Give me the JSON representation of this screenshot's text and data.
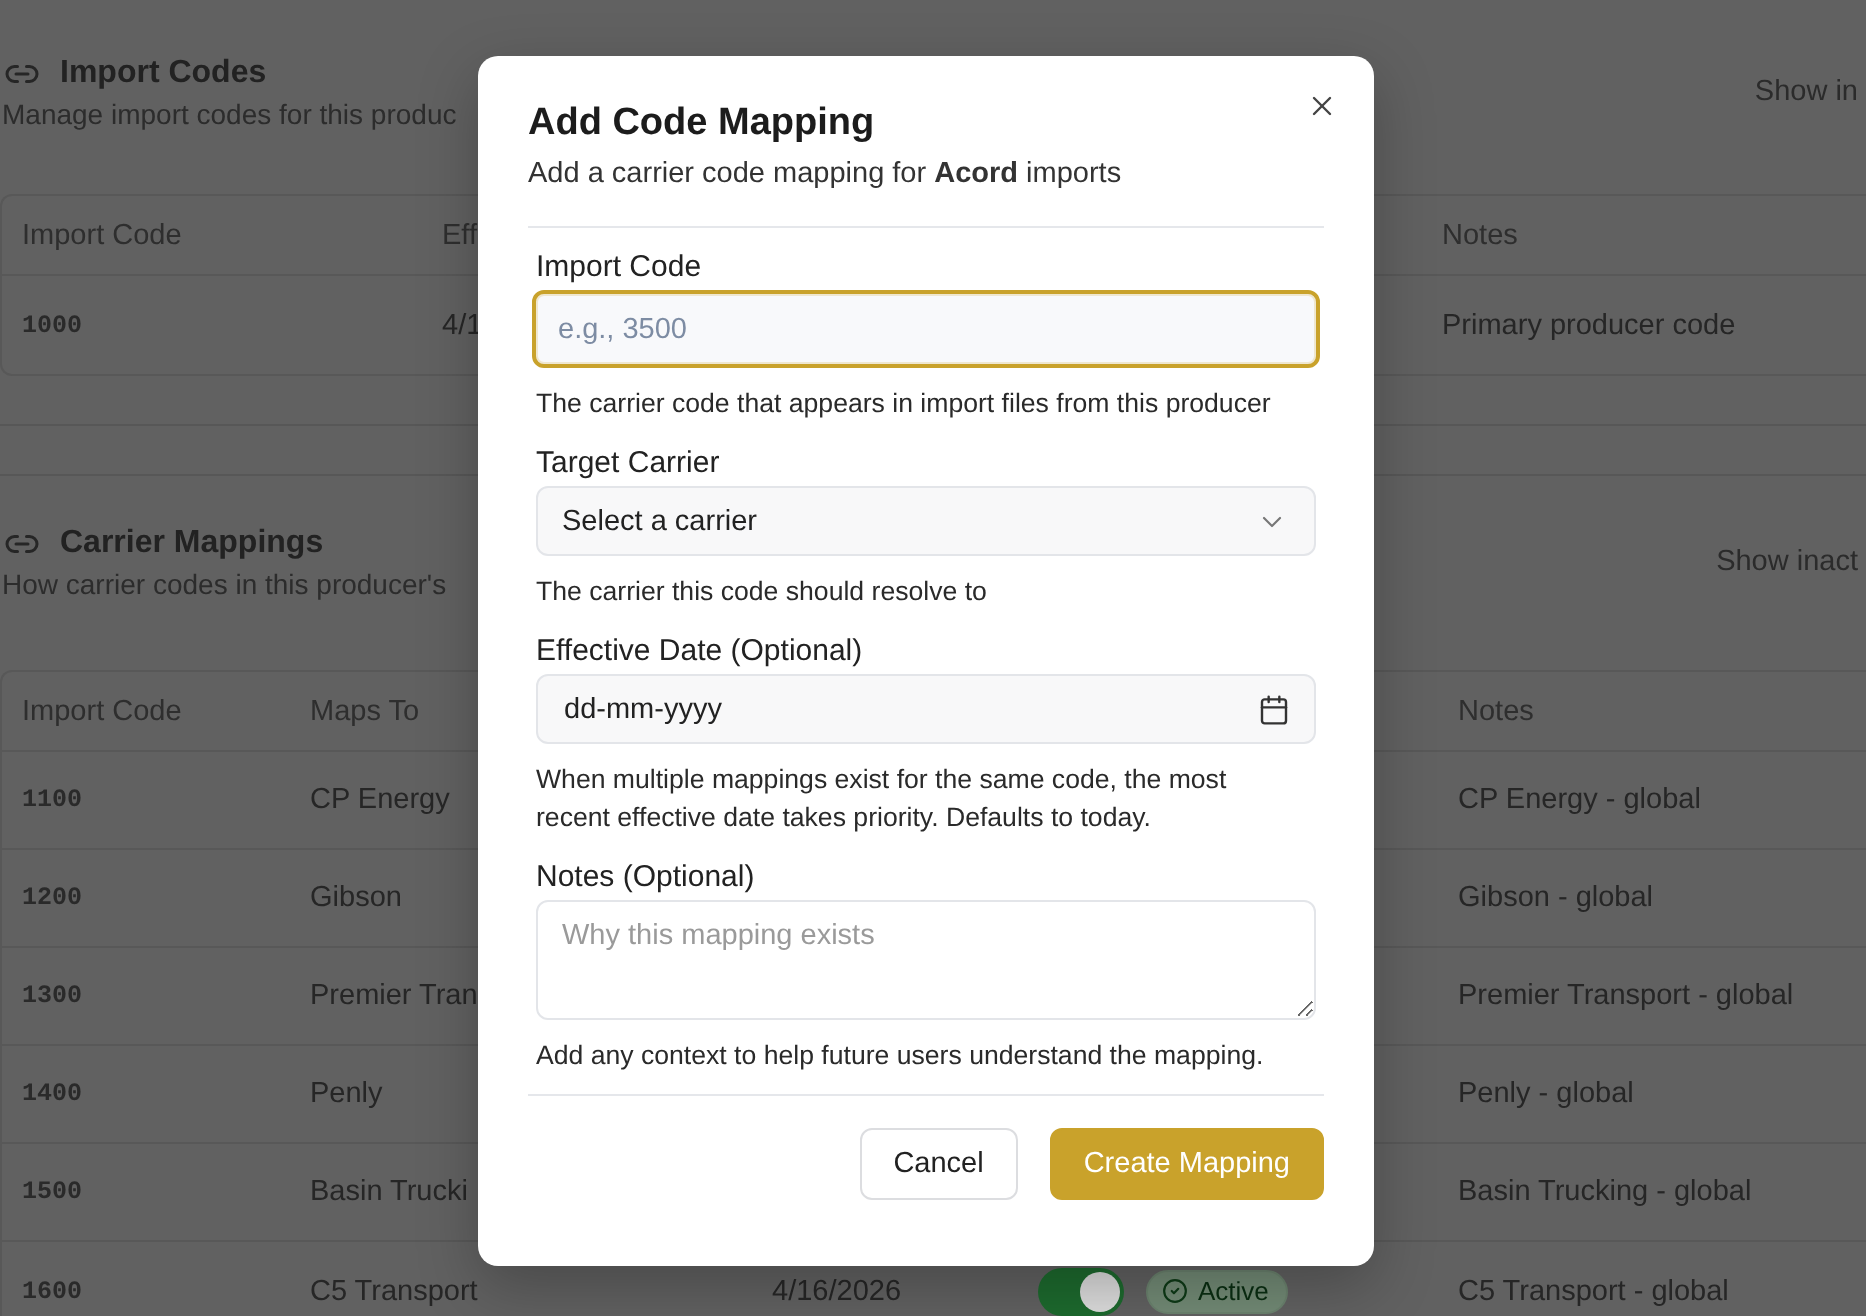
{
  "import_codes": {
    "title": "Import Codes",
    "subtitle": "Manage import codes for this produc",
    "filter_label": "Show in",
    "columns": [
      "Import Code",
      "Eff",
      "Notes"
    ],
    "rows": [
      {
        "import_code": "1000",
        "column_2": "4/1",
        "notes": "Primary producer code"
      }
    ]
  },
  "carrier_mappings": {
    "title": "Carrier Mappings",
    "subtitle": "How carrier codes in this producer's",
    "filter_label": "Show inact",
    "columns": [
      "Import Code",
      "Maps To",
      "Notes"
    ],
    "rows": [
      {
        "import_code": "1100",
        "maps_to": "CP Energy",
        "notes": "CP Energy - global"
      },
      {
        "import_code": "1200",
        "maps_to": "Gibson",
        "notes": "Gibson - global"
      },
      {
        "import_code": "1300",
        "maps_to": "Premier Tran",
        "notes": "Premier Transport - global"
      },
      {
        "import_code": "1400",
        "maps_to": "Penly",
        "notes": "Penly - global"
      },
      {
        "import_code": "1500",
        "maps_to": "Basin Trucki",
        "notes": "Basin Trucking - global"
      },
      {
        "import_code": "1600",
        "maps_to": "C5 Transport",
        "column_3": "4/16/2026",
        "column_4": {
          "on": true
        },
        "column_5": "Active",
        "notes": "C5 Transport - global"
      }
    ]
  },
  "dialog": {
    "title": "Add Code Mapping",
    "subtitle": "Add a carrier code mapping for **Acord** imports",
    "fields": [
      {
        "kind": "text",
        "label": "Import Code",
        "placeholder": "e.g., 3500",
        "focused": true,
        "hint": "The carrier code that appears in import files from this producer"
      },
      {
        "kind": "select",
        "label": "Target Carrier",
        "placeholder": "Select a carrier",
        "focused": false,
        "hint": "The carrier this code should resolve to"
      },
      {
        "kind": "date",
        "label": "Effective Date (Optional)",
        "placeholder": "dd-mm-yyyy",
        "focused": false,
        "hint": "When multiple mappings exist for the same code, the most recent effective date takes priority. Defaults to today."
      },
      {
        "kind": "textarea",
        "label": "Notes (Optional)",
        "placeholder": "Why this mapping exists",
        "focused": false,
        "hint": "Add any context to help future users understand the mapping."
      }
    ],
    "buttons": [
      {
        "kind": "cancel",
        "label": "Cancel"
      },
      {
        "kind": "submit",
        "label": "Create Mapping"
      }
    ]
  }
}
